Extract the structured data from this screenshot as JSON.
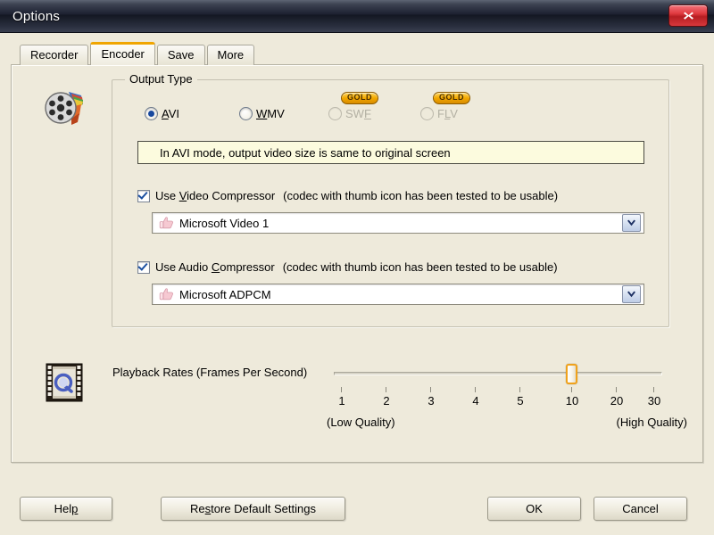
{
  "window": {
    "title": "Options",
    "close_label": "close-button"
  },
  "tabs": [
    {
      "label": "Recorder",
      "selected": false
    },
    {
      "label": "Encoder",
      "selected": true
    },
    {
      "label": "Save",
      "selected": false
    },
    {
      "label": "More",
      "selected": false
    }
  ],
  "icons": {
    "encoder": "film-reel-brush-icon",
    "playback": "film-strip-play-icon",
    "thumb": "thumbs-up-icon",
    "dropdown": "chevron-down-icon",
    "close": "close-icon"
  },
  "output_type": {
    "title": "Output Type",
    "options": [
      {
        "label": "AVI",
        "acc": "A",
        "selected": true,
        "disabled": false,
        "gold": false
      },
      {
        "label": "WMV",
        "acc": "W",
        "selected": false,
        "disabled": false,
        "gold": false
      },
      {
        "label": "SWF",
        "acc": "F",
        "selected": false,
        "disabled": true,
        "gold": true
      },
      {
        "label": "FLV",
        "acc": "L",
        "selected": false,
        "disabled": true,
        "gold": true
      }
    ],
    "gold_badge_text": "GOLD",
    "info_message": "In AVI mode, output video size is same to original screen",
    "video_compressor": {
      "label": "Use Video Compressor",
      "acc": "V",
      "hint": "(codec with thumb icon has been tested to be usable)",
      "checked": true,
      "selected_codec": "Microsoft Video 1"
    },
    "audio_compressor": {
      "label": "Use Audio Compressor",
      "acc": "C",
      "hint": "(codec with thumb icon has been tested to be usable)",
      "checked": true,
      "selected_codec": "Microsoft ADPCM"
    }
  },
  "playback_rates": {
    "label": "Playback Rates (Frames Per Second)",
    "ticks": [
      "1",
      "2",
      "3",
      "4",
      "5",
      "10",
      "20",
      "30"
    ],
    "value": "10",
    "value_index": 5,
    "low_label": "(Low Quality)",
    "high_label": "(High Quality)"
  },
  "footer": {
    "help": "Help",
    "help_acc": "p",
    "restore": "Restore Default Settings",
    "restore_acc": "s",
    "ok": "OK",
    "cancel": "Cancel"
  },
  "colors": {
    "background": "#eeeadb",
    "titlebar_dark": "#131722",
    "accent_gold": "#f0a500",
    "close_red": "#d6383c",
    "info_bg": "#fcfbde",
    "radio_blue": "#17489e"
  }
}
